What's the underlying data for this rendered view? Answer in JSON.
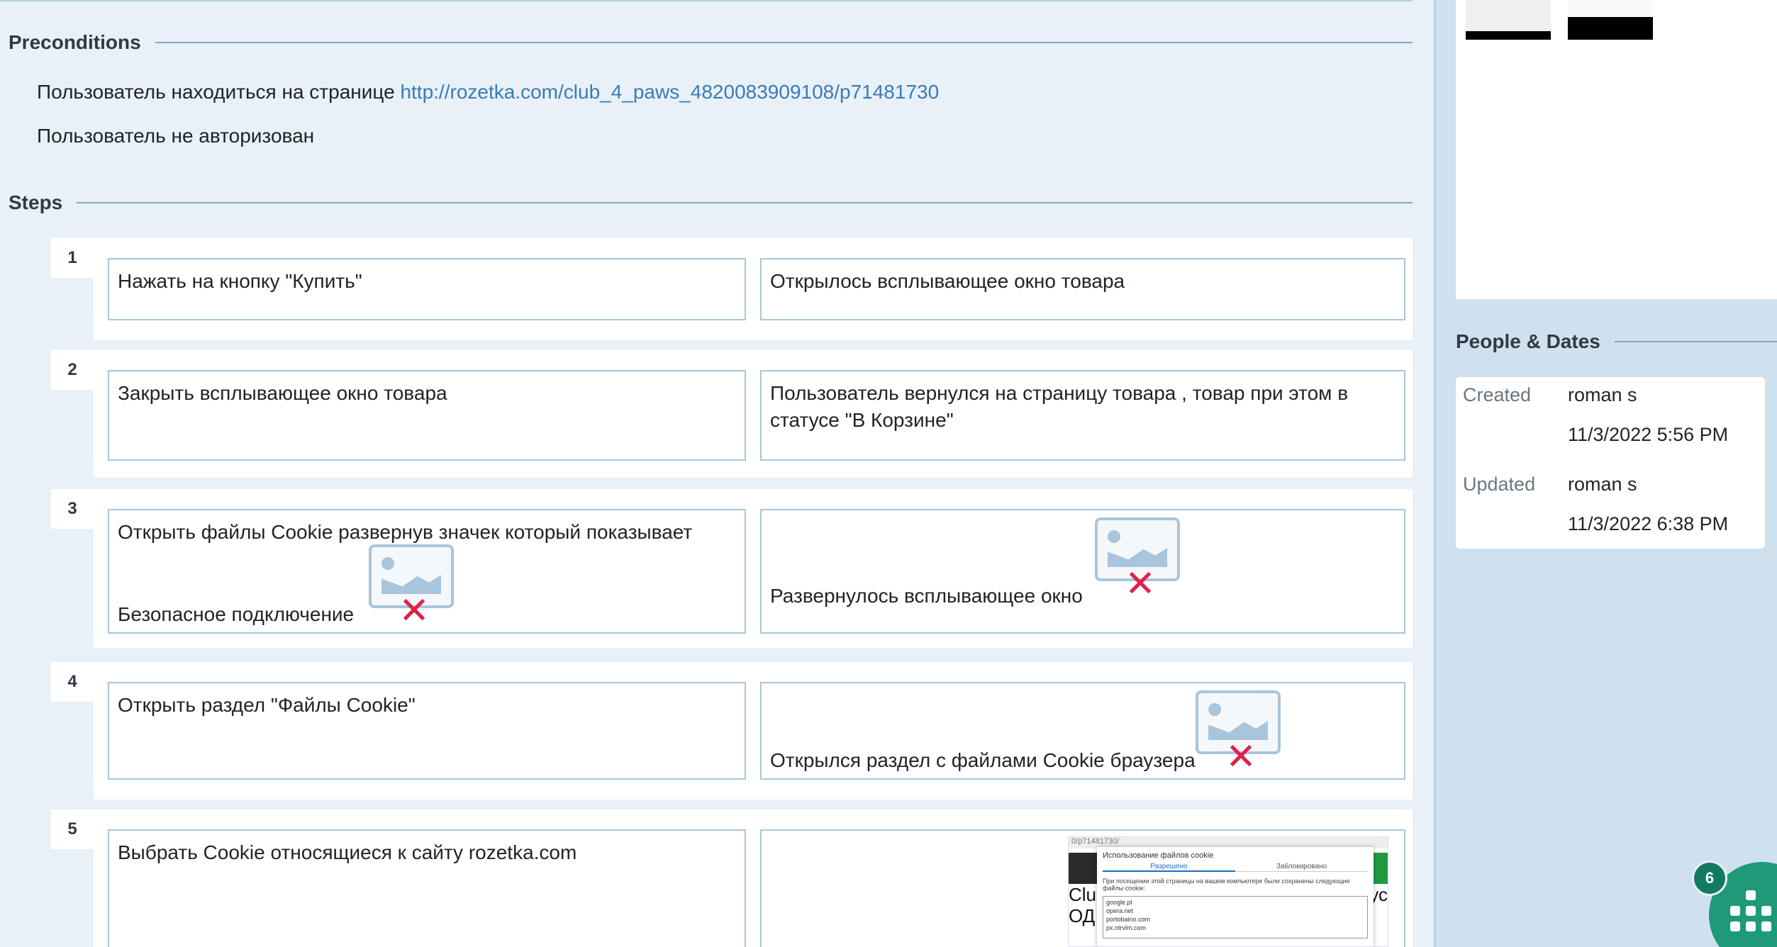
{
  "preconditions": {
    "title": "Preconditions",
    "line1_text": "Пользователь находиться на странице ",
    "line1_link": "http://rozetka.com/club_4_paws_4820083909108/p71481730",
    "line2_text": "Пользователь не авторизован"
  },
  "steps_section": {
    "title": "Steps",
    "steps": [
      {
        "num": "1",
        "action": "Нажать на кнопку \"Купить\"",
        "expected": "Открылось всплывающее окно товара"
      },
      {
        "num": "2",
        "action": "Закрыть всплывающее окно товара",
        "expected": "Пользователь вернулся на страницу товара , товар при этом в статусе \"В Корзине\""
      },
      {
        "num": "3",
        "action_line1": "Открыть файлы Cookie развернув значек который показывает",
        "action_line2": "Безопасное подключение",
        "expected": "Развернулось всплывающее окно"
      },
      {
        "num": "4",
        "action": "Открыть раздел \"Файлы Cookie\"",
        "expected": "Открылся раздел с файлами Cookie браузера"
      },
      {
        "num": "5",
        "action": "Выбрать Cookie относящиеся к сайту rozetka.com",
        "expected": ""
      }
    ]
  },
  "screenshot": {
    "url_bar": "0/p71481730/",
    "modal_title": "Использование файлов cookie",
    "tab_allowed": "Разрешено",
    "tab_blocked": "Заблокировано",
    "description": "При посещении этой страницы на вашем компьютере были сохранены следующие файлы cookie:",
    "list": [
      "google.pl",
      "opera.net",
      "portobaino.com",
      "px.ntrvlm.com"
    ],
    "overlay_left": "Clu\nОД",
    "overlay_right": "кус"
  },
  "sidebar": {
    "people_dates_title": "People & Dates",
    "created_label": "Created",
    "created_by": "roman s",
    "created_at": "11/3/2022 5:56 PM",
    "updated_label": "Updated",
    "updated_by": "roman s",
    "updated_at": "11/3/2022 6:38 PM"
  },
  "fab": {
    "badge_count": "6",
    "icon": "apps-grid-icon"
  },
  "colors": {
    "page_bg": "#e8f0f8",
    "link": "#3b7bb3",
    "rule": "#7fa9c9",
    "fab": "#1e9a78",
    "error_x": "#e0204a"
  }
}
